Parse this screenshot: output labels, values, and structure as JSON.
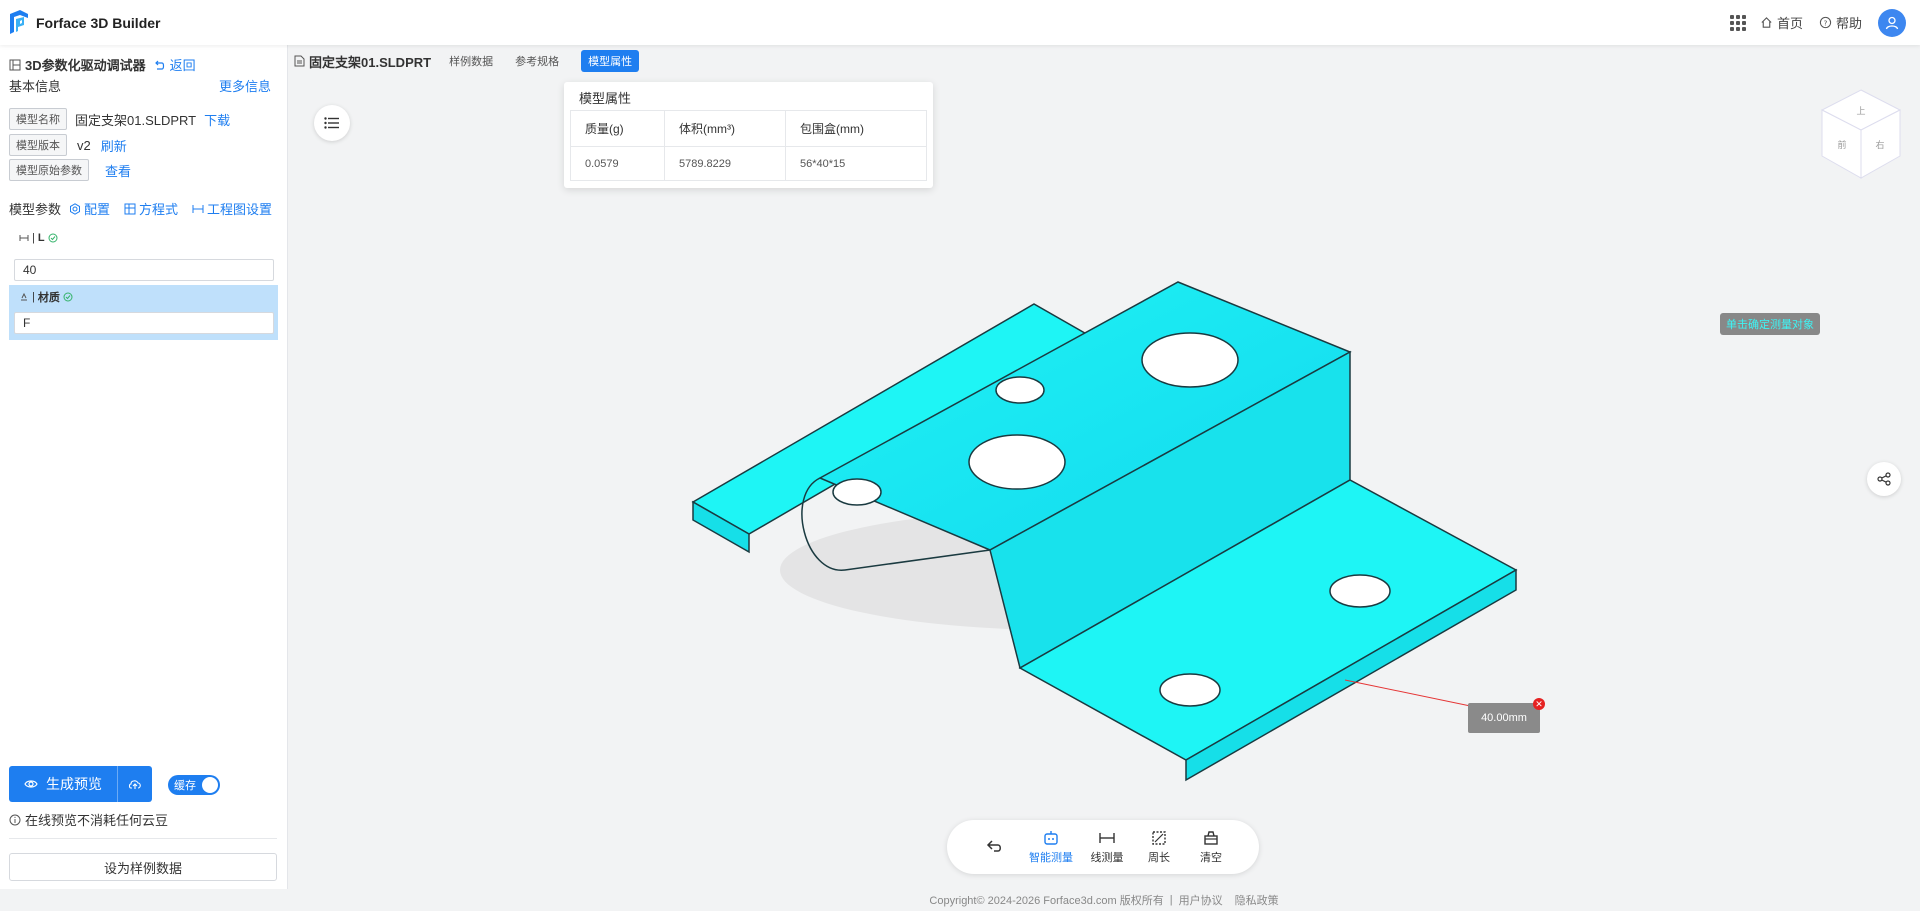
{
  "app": {
    "name": "Forface 3D Builder"
  },
  "header": {
    "home_label": "首页",
    "help_label": "帮助"
  },
  "sidebar": {
    "title": "3D参数化驱动调试器",
    "back_label": "返回",
    "basic_info_label": "基本信息",
    "more_info_label": "更多信息",
    "model_name_tag": "模型名称",
    "model_name_value": "固定支架01.SLDPRT",
    "download_label": "下载",
    "model_version_tag": "模型版本",
    "model_version_value": "v2",
    "refresh_label": "刷新",
    "model_params_raw_tag": "模型原始参数",
    "view_label": "查看",
    "model_params_label": "模型参数",
    "config_label": "配置",
    "equation_label": "方程式",
    "drawing_settings_label": "工程图设置",
    "param_L": {
      "label": "L",
      "value": "40"
    },
    "param_material": {
      "label": "材质",
      "value": "F"
    },
    "generate_preview_label": "生成预览",
    "cache_label": "缓存",
    "info_text": "在线预览不消耗任何云豆",
    "set_sample_label": "设为样例数据"
  },
  "topbar": {
    "file_title": "固定支架01.SLDPRT",
    "tabs": [
      "样例数据",
      "参考规格",
      "模型属性"
    ]
  },
  "props_panel": {
    "title": "模型属性",
    "headers": [
      "质量(g)",
      "体积(mm³)",
      "包围盒(mm)"
    ],
    "values": [
      "0.0579",
      "5789.8229",
      "56*40*15"
    ]
  },
  "viewer": {
    "hint": "单击确定测量对象",
    "measure_value": "40.00mm",
    "model_color": "#1ef5f5"
  },
  "toolbar": {
    "tools": [
      "智能测量",
      "线测量",
      "周长",
      "清空"
    ]
  },
  "footer": {
    "copyright": "Copyright© 2024-2026 Forface3d.com 版权所有",
    "agreement": "用户协议",
    "privacy": "隐私政策"
  }
}
